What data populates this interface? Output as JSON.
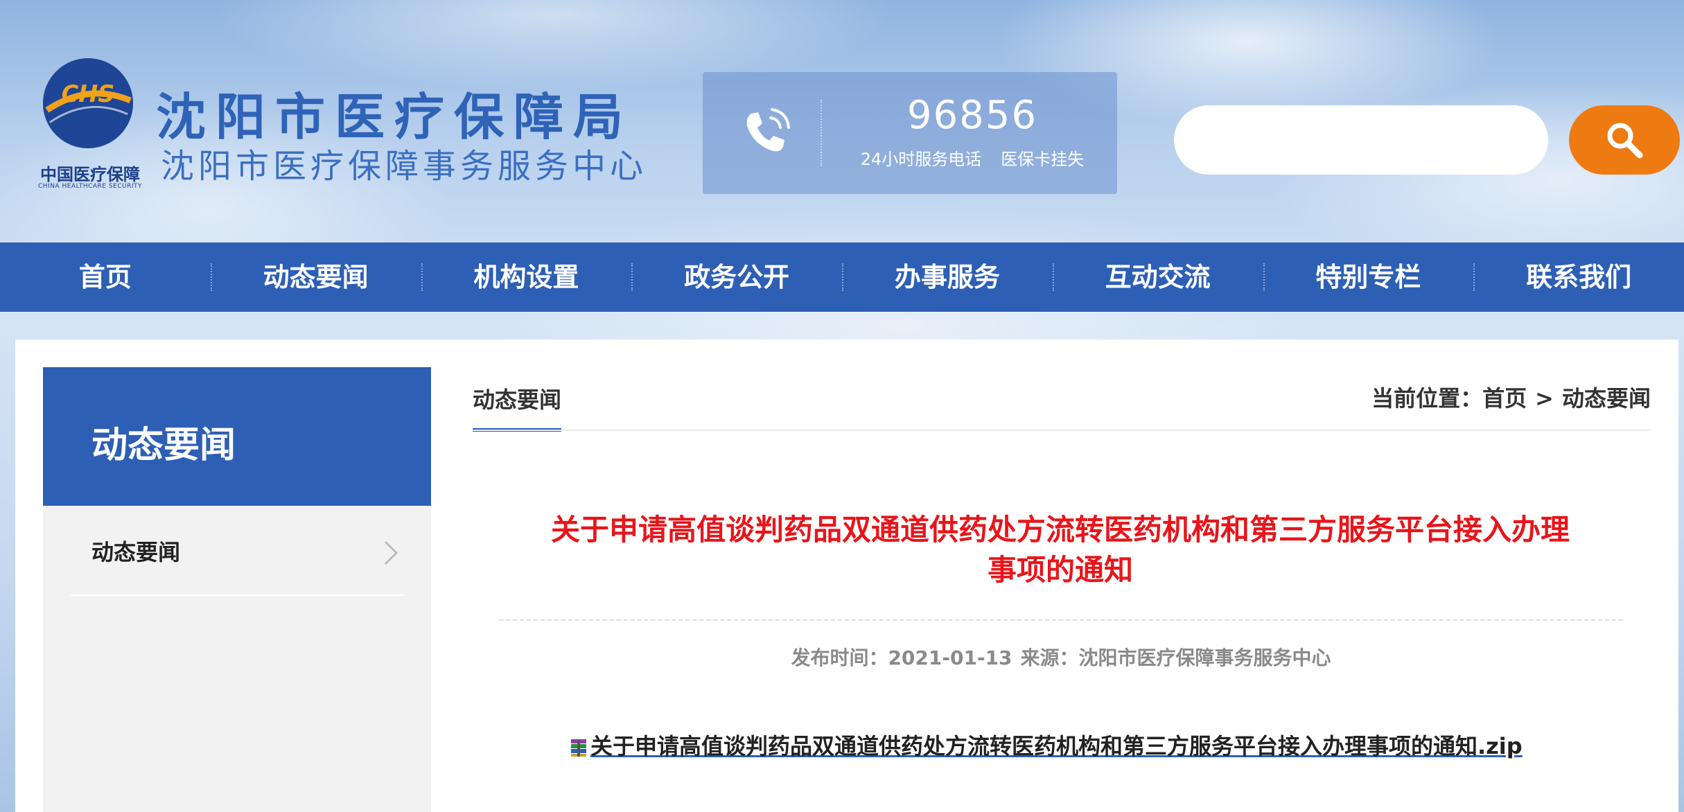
{
  "header": {
    "logo": {
      "mark": "CHS",
      "cn": "中国医疗保障",
      "en": "CHINA HEALTHCARE SECURITY"
    },
    "title": "沈阳市医疗保障局",
    "subtitle": "沈阳市医疗保障事务服务中心",
    "hotline": {
      "number": "96856",
      "desc_1": "24小时服务电话",
      "desc_2": "医保卡挂失",
      "icon": "phone-icon"
    },
    "search": {
      "placeholder": "",
      "icon": "search-icon",
      "accent": "#ee7a12"
    }
  },
  "nav": {
    "items": [
      "首页",
      "动态要闻",
      "机构设置",
      "政务公开",
      "办事服务",
      "互动交流",
      "特别专栏",
      "联系我们"
    ],
    "color": "#2d5fb5"
  },
  "sidebar": {
    "title": "动态要闻",
    "items": [
      {
        "label": "动态要闻",
        "icon": "chevron-right-icon"
      }
    ]
  },
  "main": {
    "tab": "动态要闻",
    "breadcrumb": {
      "prefix": "当前位置：",
      "home": "首页",
      "separator": ">",
      "current": "动态要闻"
    },
    "article": {
      "title": "关于申请高值谈判药品双通道供药处方流转医药机构和第三方服务平台接入办理事项的通知",
      "title_color": "#e8151b",
      "publish_time": "发布时间：2021-01-13",
      "source": "来源：沈阳市医疗保障事务服务中心",
      "attachment": "关于申请高值谈判药品双通道供药处方流转医药机构和第三方服务平台接入办理事项的通知.zip"
    }
  }
}
